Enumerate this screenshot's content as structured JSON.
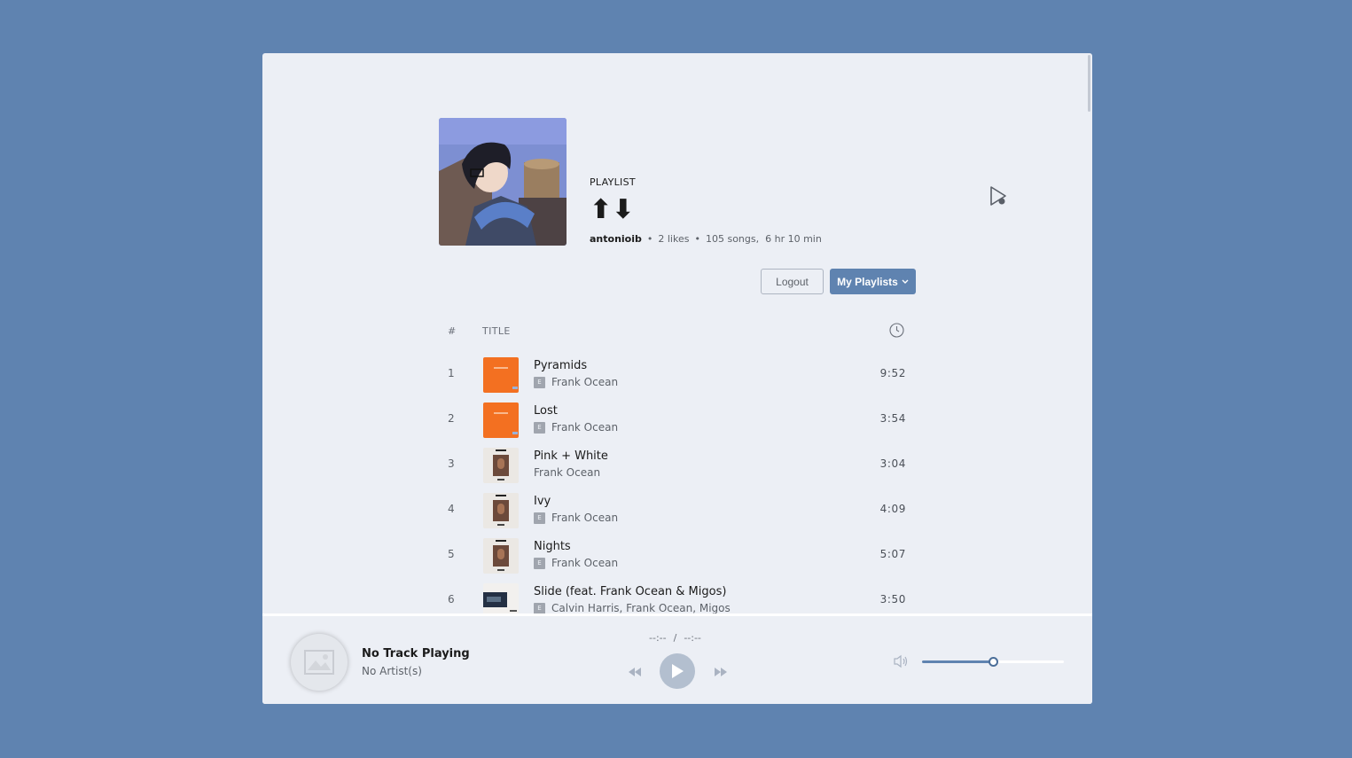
{
  "playlist": {
    "type_label": "PLAYLIST",
    "title": "⬆⬇",
    "owner": "antonioib",
    "likes": "2 likes",
    "song_count": "105 songs,",
    "duration": "6 hr 10 min"
  },
  "actions": {
    "logout_label": "Logout",
    "playlists_label": "My Playlists"
  },
  "table": {
    "col_num": "#",
    "col_title": "TITLE",
    "rows": [
      {
        "num": "1",
        "title": "Pyramids",
        "artist": "Frank Ocean",
        "explicit": "E",
        "duration": "9:52",
        "art": "orange"
      },
      {
        "num": "2",
        "title": "Lost",
        "artist": "Frank Ocean",
        "explicit": "E",
        "duration": "3:54",
        "art": "orange"
      },
      {
        "num": "3",
        "title": "Pink + White",
        "artist": "Frank Ocean",
        "explicit": "",
        "duration": "3:04",
        "art": "blonde"
      },
      {
        "num": "4",
        "title": "Ivy",
        "artist": "Frank Ocean",
        "explicit": "E",
        "duration": "4:09",
        "art": "blonde"
      },
      {
        "num": "5",
        "title": "Nights",
        "artist": "Frank Ocean",
        "explicit": "E",
        "duration": "5:07",
        "art": "blonde"
      },
      {
        "num": "6",
        "title": "Slide (feat. Frank Ocean & Migos)",
        "artist": "Calvin Harris, Frank Ocean, Migos",
        "explicit": "E",
        "duration": "3:50",
        "art": "funk"
      }
    ]
  },
  "player": {
    "track_title": "No Track Playing",
    "track_artist": "No Artist(s)",
    "elapsed": "--:--",
    "separator": "/",
    "total": "--:--",
    "volume": 0.5
  },
  "colors": {
    "accent": "#5f83b0",
    "background": "#eceff5"
  }
}
